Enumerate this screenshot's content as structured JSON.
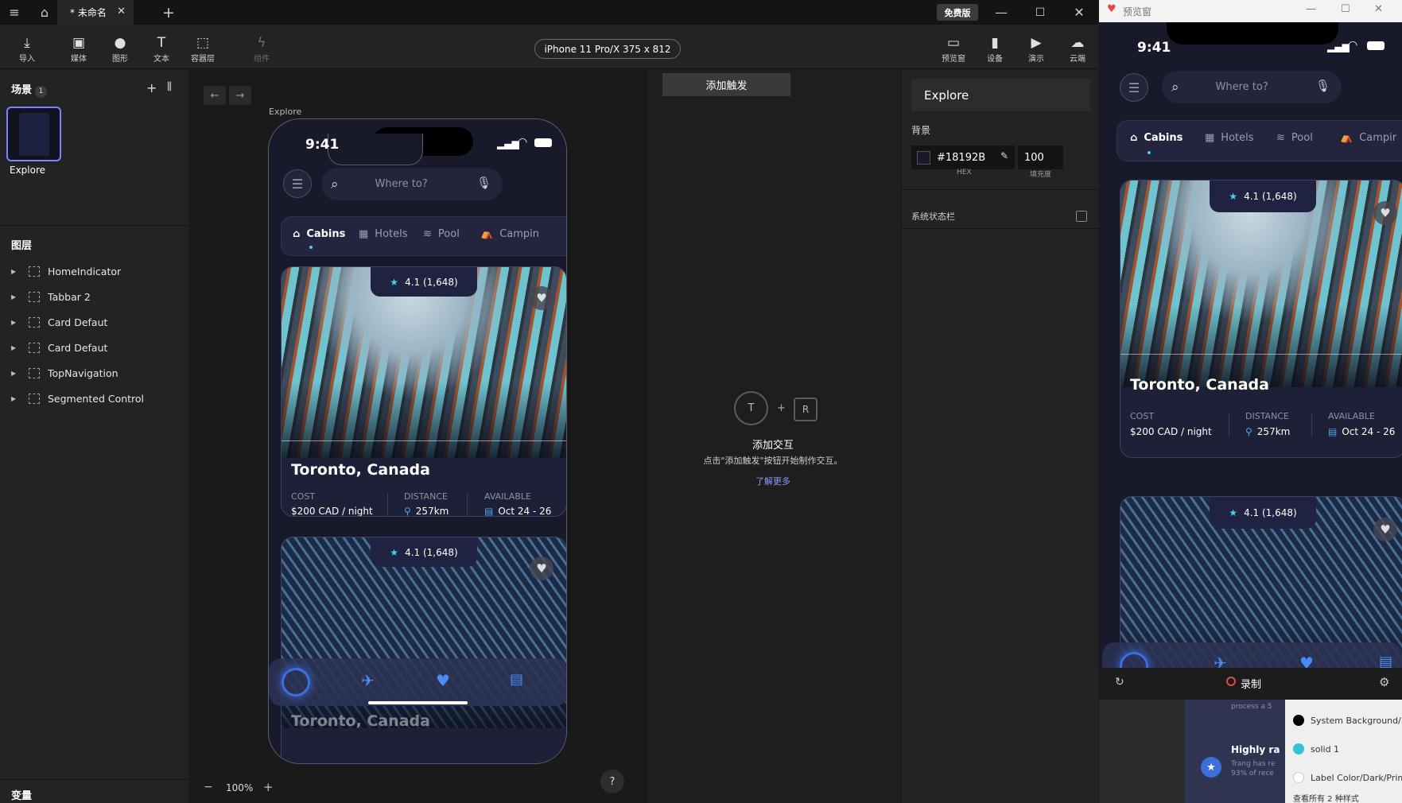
{
  "titlebar": {
    "doc_tab": "* 未命名",
    "free_badge": "免费版"
  },
  "toolbar": {
    "tools": [
      "导入",
      "媒体",
      "图形",
      "文本",
      "容器层",
      "组件"
    ],
    "device": "iPhone 11 Pro/X  375 x 812",
    "right_tools": [
      "预览窗",
      "设备",
      "演示",
      "云端"
    ]
  },
  "left": {
    "scenes_title": "场景",
    "scenes_count": "1",
    "scene_name": "Explore",
    "layers_title": "图层",
    "layers": [
      "HomeIndicator",
      "Tabbar 2",
      "Card Defaut",
      "Card Defaut",
      "TopNavigation",
      "Segmented Control"
    ],
    "vars_title": "变量"
  },
  "canvas": {
    "frame_label": "Explore",
    "zoom": "100%",
    "help": "?"
  },
  "phone": {
    "time": "9:41",
    "search_placeholder": "Where to?",
    "tabs": [
      "Cabins",
      "Hotels",
      "Pool",
      "Campin"
    ],
    "card1": {
      "rating": "4.1 (1,648)",
      "city": "Toronto, Canada",
      "cost_label": "COST",
      "cost": "$200 CAD / night",
      "distance_label": "DISTANCE",
      "distance": "257km",
      "available_label": "AVAILABLE",
      "available": "Oct 24 - 26"
    },
    "card2": {
      "rating": "4.1 (1,648)",
      "city": "Toronto, Canada"
    }
  },
  "interaction": {
    "add_trigger": "添加触发",
    "key_t": "T",
    "key_r": "R",
    "title": "添加交互",
    "desc": "点击\"添加触发\"按钮开始制作交互。",
    "learn_more": "了解更多"
  },
  "right": {
    "scene_name": "Explore",
    "bg_label": "背景",
    "hex": "#18192B",
    "fill": "100",
    "hex_label": "HEX",
    "fill_label": "填充度",
    "status_bar": "系统状态栏"
  },
  "preview": {
    "title": "预览窗",
    "time": "9:41",
    "tabs": [
      "Cabins",
      "Hotels",
      "Pool",
      "Campir"
    ],
    "record": "录制",
    "below_text_1": "process a 5",
    "below_text_2": "Highly ra",
    "below_text_3": "Trang has re",
    "below_text_4": "93% of rece",
    "popover": [
      "System Background/D",
      "solid 1",
      "Label Color/Dark/Prim"
    ],
    "popover_tail": "查看所有 2 种样式"
  },
  "colors": {
    "accent": "#7b83ff",
    "phone_bg": "#18192b",
    "star": "#3ed3f0",
    "tab_icon": "#4a8df0"
  }
}
